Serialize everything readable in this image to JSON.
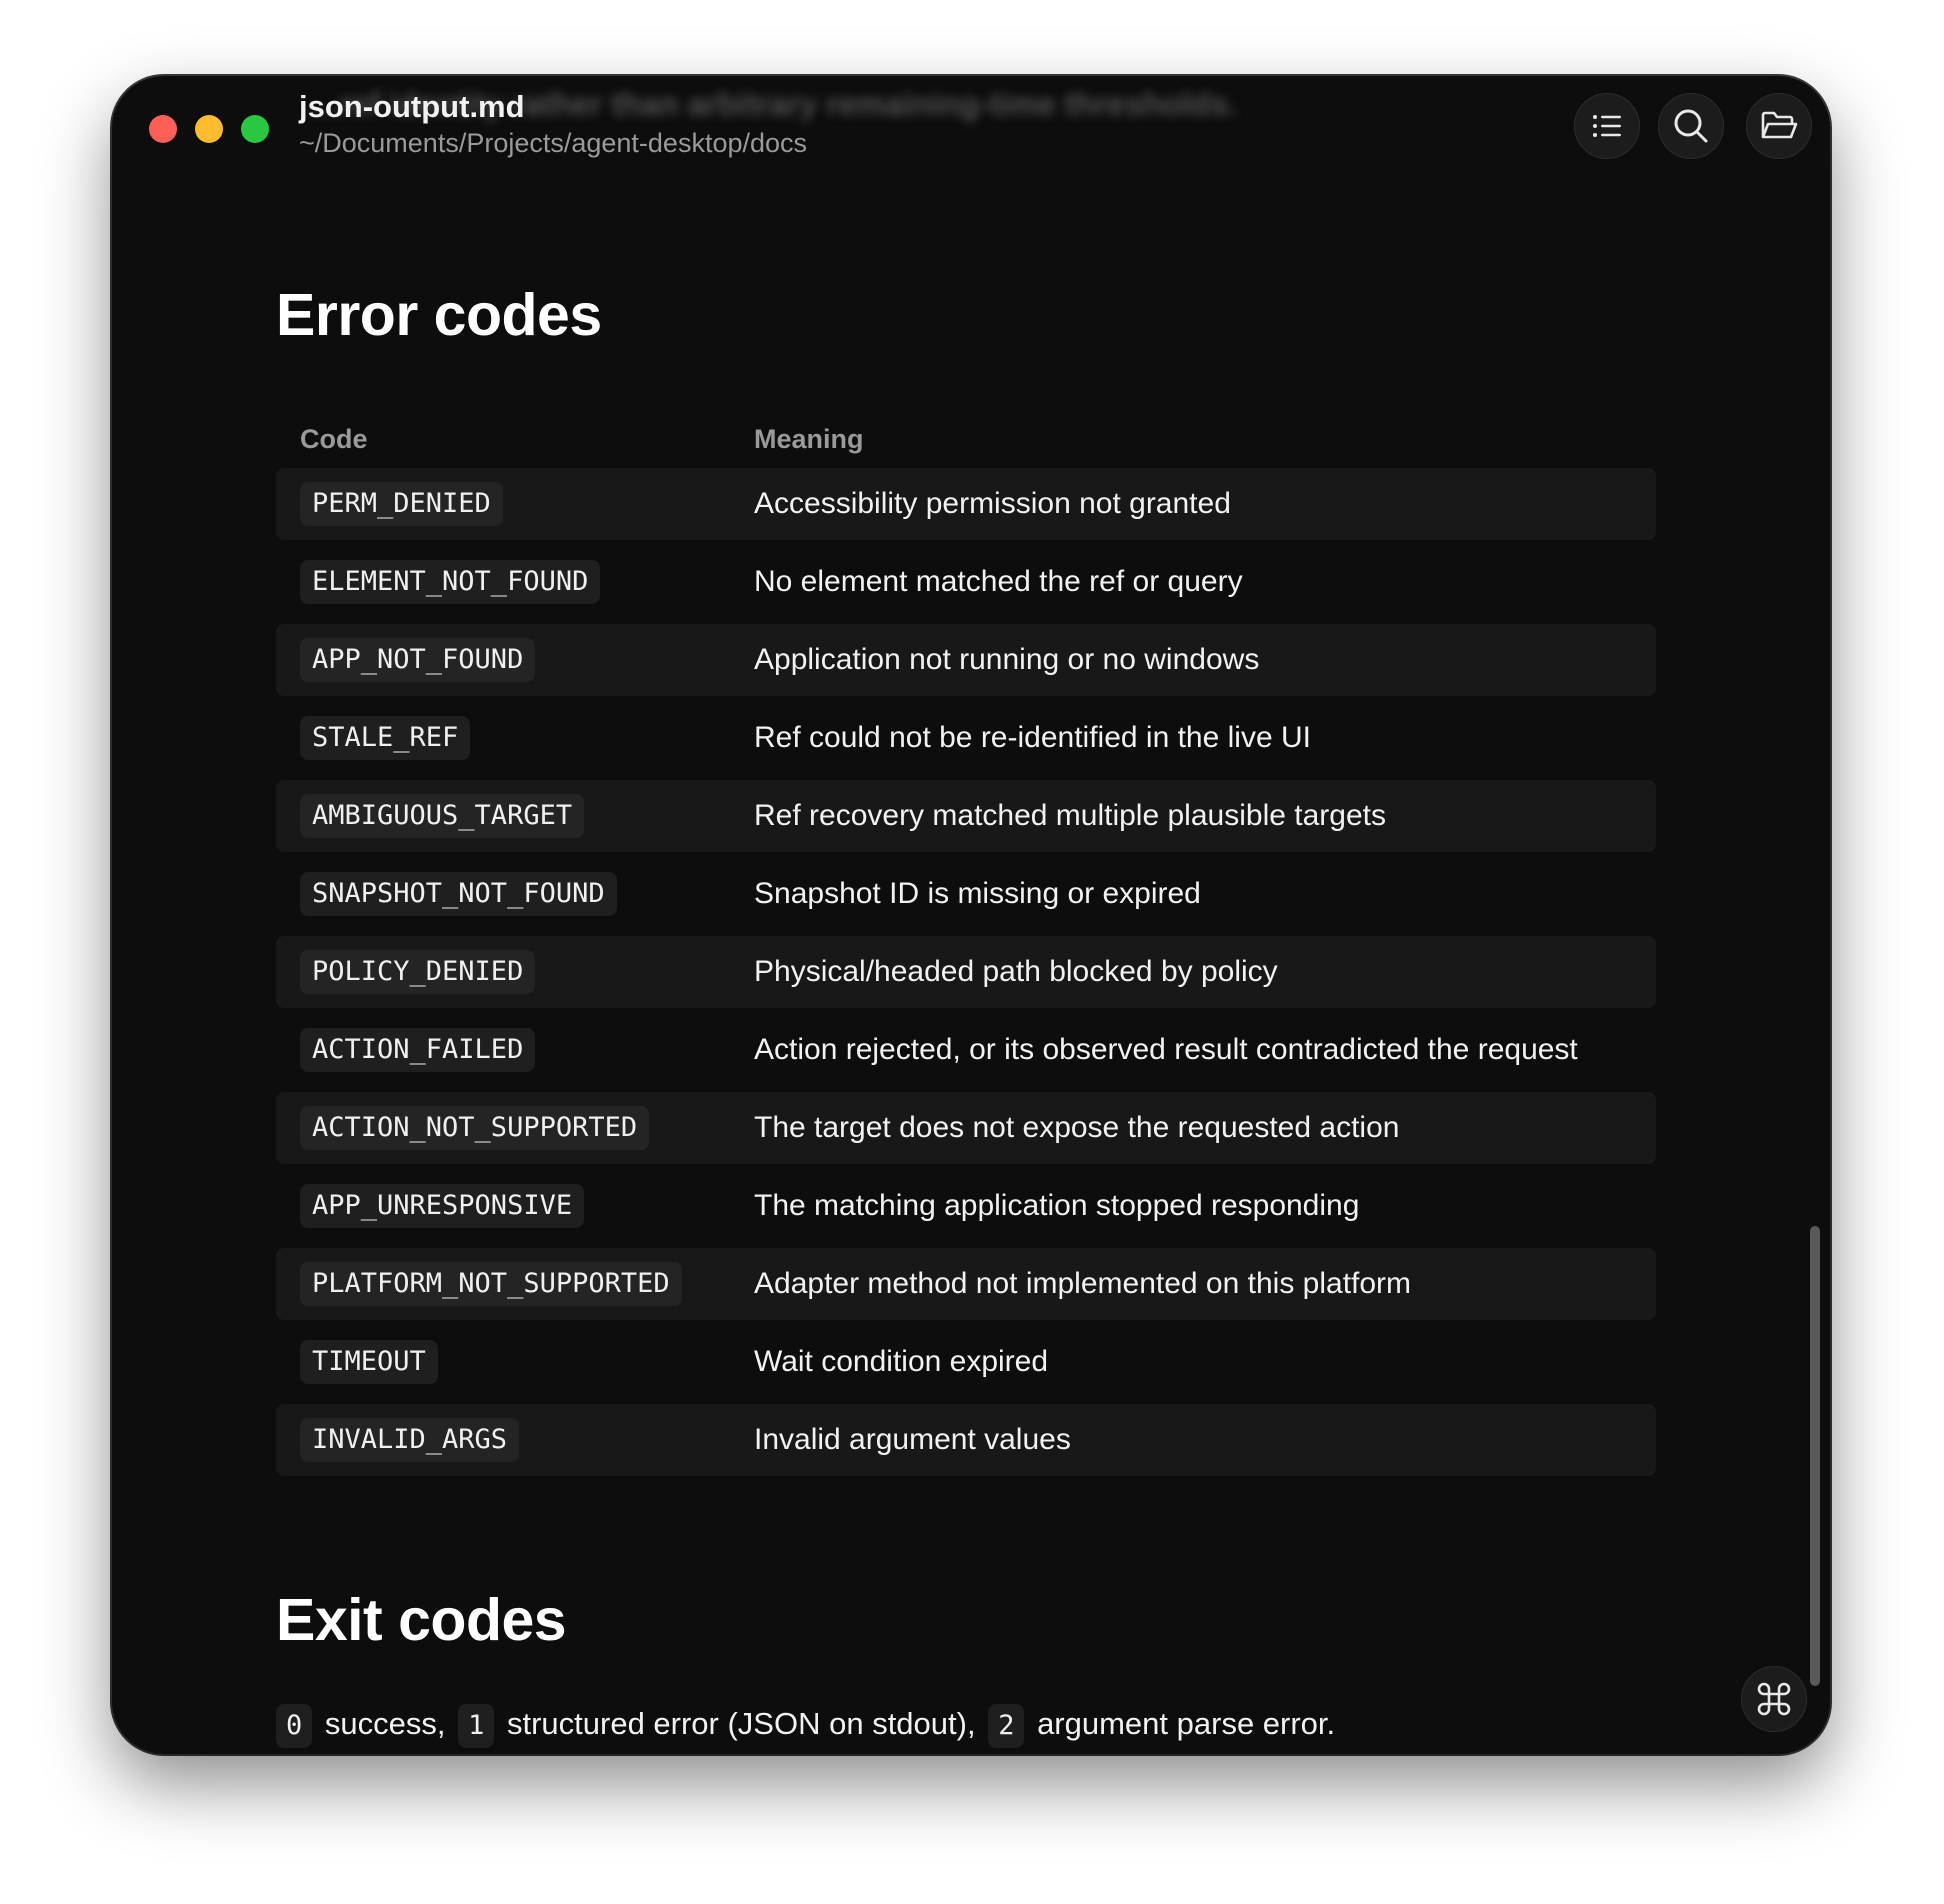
{
  "window": {
    "title": "json-output.md",
    "path": "~/Documents/Projects/agent-desktop/docs",
    "ghost_text": "…ref identity rather than arbitrary remaining-time thresholds."
  },
  "toolbar": {
    "toc_icon": "list-icon",
    "search_icon": "search-icon",
    "folder_icon": "folder-open-icon"
  },
  "error_section": {
    "heading": "Error codes",
    "columns": [
      "Code",
      "Meaning"
    ],
    "rows": [
      {
        "code": "PERM_DENIED",
        "meaning": "Accessibility permission not granted"
      },
      {
        "code": "ELEMENT_NOT_FOUND",
        "meaning": "No element matched the ref or query"
      },
      {
        "code": "APP_NOT_FOUND",
        "meaning": "Application not running or no windows"
      },
      {
        "code": "STALE_REF",
        "meaning": "Ref could not be re-identified in the live UI"
      },
      {
        "code": "AMBIGUOUS_TARGET",
        "meaning": "Ref recovery matched multiple plausible targets"
      },
      {
        "code": "SNAPSHOT_NOT_FOUND",
        "meaning": "Snapshot ID is missing or expired"
      },
      {
        "code": "POLICY_DENIED",
        "meaning": "Physical/headed path blocked by policy"
      },
      {
        "code": "ACTION_FAILED",
        "meaning": "Action rejected, or its observed result contradicted the request"
      },
      {
        "code": "ACTION_NOT_SUPPORTED",
        "meaning": "The target does not expose the requested action"
      },
      {
        "code": "APP_UNRESPONSIVE",
        "meaning": "The matching application stopped responding"
      },
      {
        "code": "PLATFORM_NOT_SUPPORTED",
        "meaning": "Adapter method not implemented on this platform"
      },
      {
        "code": "TIMEOUT",
        "meaning": "Wait condition expired"
      },
      {
        "code": "INVALID_ARGS",
        "meaning": "Invalid argument values"
      }
    ]
  },
  "exit_section": {
    "heading": "Exit codes",
    "code_0": "0",
    "text_0": " success, ",
    "code_1": "1",
    "text_1": " structured error (JSON on stdout), ",
    "code_2": "2",
    "text_2": " argument parse error."
  },
  "colors": {
    "background": "#0d0d0d",
    "close": "#ff5f57",
    "minimize": "#febc2e",
    "maximize": "#28c840"
  }
}
